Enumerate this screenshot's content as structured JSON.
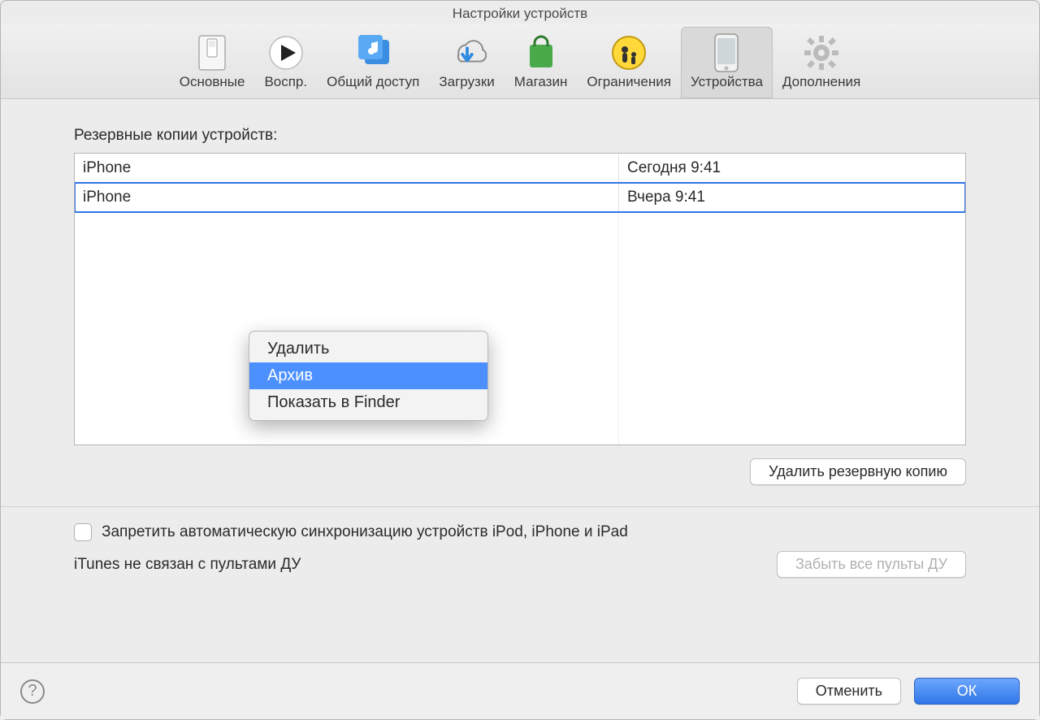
{
  "window": {
    "title": "Настройки устройств"
  },
  "toolbar": {
    "tabs": [
      {
        "label": "Основные"
      },
      {
        "label": "Воспр."
      },
      {
        "label": "Общий доступ"
      },
      {
        "label": "Загрузки"
      },
      {
        "label": "Магазин"
      },
      {
        "label": "Ограничения"
      },
      {
        "label": "Устройства"
      },
      {
        "label": "Дополнения"
      }
    ]
  },
  "main": {
    "section_label": "Резервные копии устройств:",
    "backups": [
      {
        "name": "iPhone",
        "date": "Сегодня 9:41"
      },
      {
        "name": "iPhone",
        "date": "Вчера 9:41"
      }
    ],
    "delete_backup_button": "Удалить резервную копию",
    "context_menu": {
      "items": [
        {
          "label": "Удалить"
        },
        {
          "label": "Архив"
        },
        {
          "label": "Показать в Finder"
        }
      ]
    },
    "prevent_sync_label": "Запретить автоматическую синхронизацию устройств iPod, iPhone и iPad",
    "remotes_status": "iTunes не связан с пультами ДУ",
    "forget_remotes_button": "Забыть все пульты ДУ"
  },
  "footer": {
    "cancel": "Отменить",
    "ok": "ОК",
    "help_symbol": "?"
  }
}
